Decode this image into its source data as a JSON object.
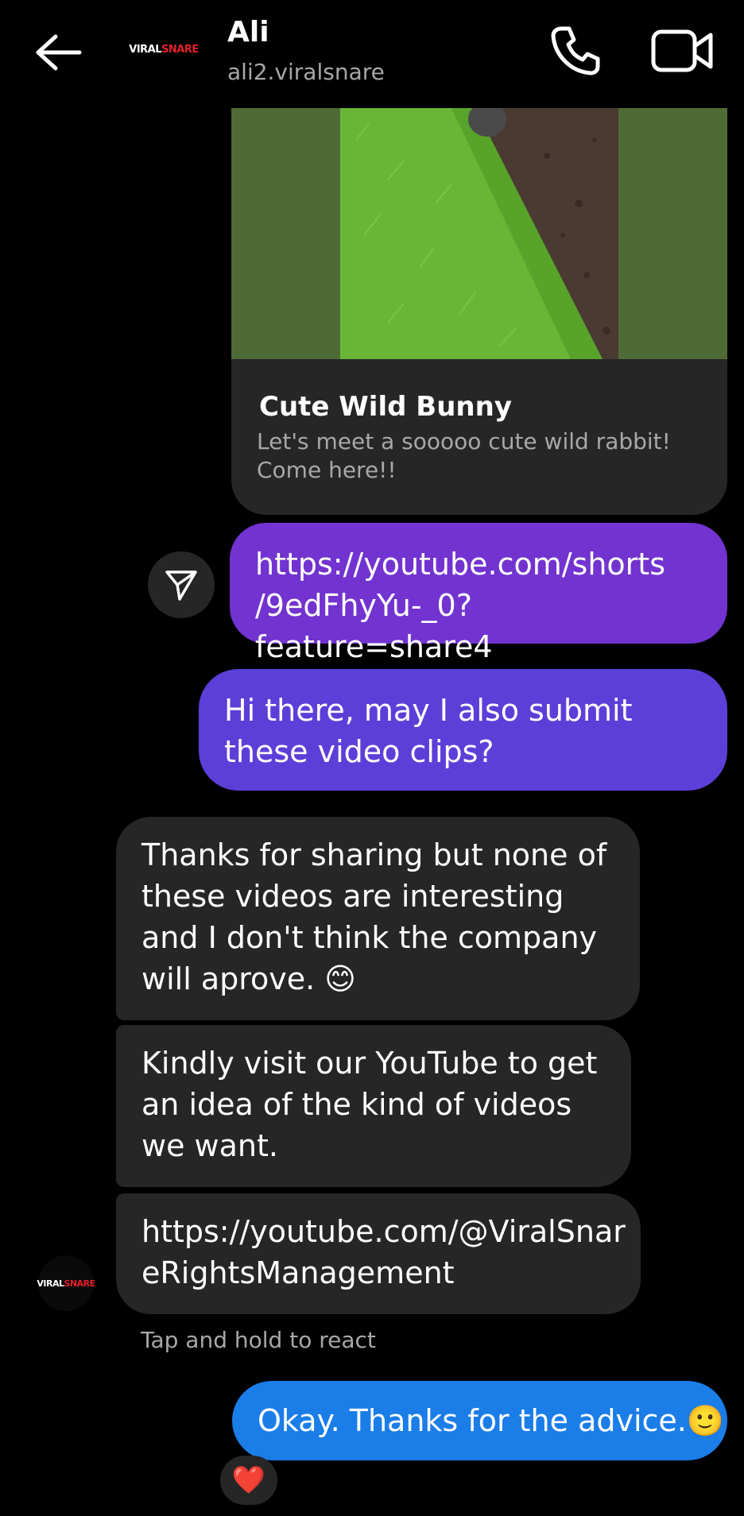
{
  "header": {
    "name": "Ali",
    "username": "ali2.viralsnare",
    "logo_text_white": "VIRAL",
    "logo_text_red": "SNARE",
    "icons": {
      "back": "arrow-left-icon",
      "call": "phone-icon",
      "video": "video-camera-icon"
    }
  },
  "preview": {
    "title": "Cute Wild Bunny",
    "description": "Let's meet a sooooo cute wild rabbit! Come here!!"
  },
  "messages": {
    "out_link": "https://youtube.com/shorts\n/9edFhyYu-_0?feature=share4",
    "out_question": "Hi there, may I also submit these video clips?",
    "in_1": "Thanks for sharing but none of these videos are interesting and I don't think the company will aprove. 😊",
    "in_2": "Kindly visit our YouTube to get an idea of the kind of videos we want.",
    "in_3": "https://youtube.com/@ViralSnar\neRightsManagement",
    "out_final": "Okay. Thanks for the advice.🙂"
  },
  "hint": "Tap and hold to react",
  "reaction": "❤️",
  "colors": {
    "background": "#000000",
    "incoming_bubble": "#262626",
    "outgoing_purple": "#7233d0",
    "outgoing_indigo": "#5c3fd8",
    "outgoing_blue": "#1a7de8",
    "secondary_text": "#a8a8a8"
  }
}
